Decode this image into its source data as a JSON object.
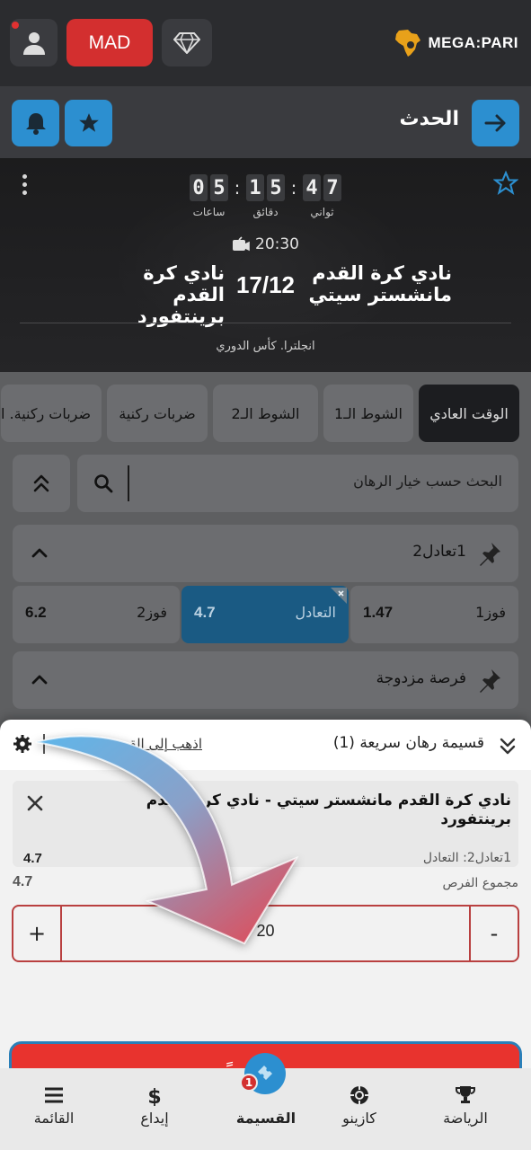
{
  "header": {
    "currency": "MAD",
    "logo_text": "MEGA:PARI",
    "icons": {
      "user": "user-icon",
      "gem": "diamond-icon",
      "logo": "africa-logo-icon"
    }
  },
  "event_bar": {
    "title": "الحدث",
    "icons": {
      "back": "arrow-right-icon",
      "bell": "bell-icon",
      "star": "star-icon"
    }
  },
  "match": {
    "timer": {
      "seconds": "47",
      "minutes": "15",
      "hours": "05",
      "seconds_label": "ثواني",
      "minutes_label": "دقائق",
      "hours_label": "ساعات"
    },
    "kickoff_time": "20:30",
    "home_team": "نادي كرة القدم مانشستر سيتي",
    "away_team": "نادي كرة القدم برينتفورد",
    "date": "17/12",
    "league": "انجلترا. كأس الدوري"
  },
  "market_tabs": [
    {
      "label": "الوقت العادي",
      "active": true
    },
    {
      "label": "الشوط الـ1",
      "active": false
    },
    {
      "label": "الشوط الـ2",
      "active": false
    },
    {
      "label": "ضربات ركنية",
      "active": false
    },
    {
      "label": "ضربات ركنية. ا",
      "active": false
    }
  ],
  "search": {
    "placeholder": "البحث حسب خيار الرهان"
  },
  "markets": [
    {
      "title": "1تعادل2",
      "outcomes": [
        {
          "label": "فوز1",
          "value": "1.47",
          "selected": false
        },
        {
          "label": "التعادل",
          "value": "4.7",
          "selected": true
        },
        {
          "label": "فوز2",
          "value": "6.2",
          "selected": false
        }
      ]
    },
    {
      "title": "فرصة مزدوجة"
    }
  ],
  "bet_slip": {
    "title": "قسيمة رهان سريعة (1)",
    "goto_link": "اذهب إلى القسيمة",
    "bet": {
      "match": "نادي كرة القدم مانشستر سيتي - نادي كرة القدم برينتفورد",
      "selection": "1تعادل2: التعادل",
      "odds": "4.7"
    },
    "total_odds_label": "مجموع الفرص",
    "total_odds": "4.7",
    "stake": "20",
    "plus": "+",
    "minus": "-",
    "place_bet": "ضع رهاناً"
  },
  "bottom_nav": [
    {
      "label": "الرياضة",
      "icon": "trophy-icon"
    },
    {
      "label": "كازينو",
      "icon": "casino-chip-icon"
    },
    {
      "label": "القسيمة",
      "icon": "ticket-icon",
      "badge": "1",
      "active": true
    },
    {
      "label": "إيداع",
      "icon": "dollar-icon"
    },
    {
      "label": "القائمة",
      "icon": "menu-icon"
    }
  ],
  "colors": {
    "accent_blue": "#2c8fd0",
    "brand_red": "#d32f2f",
    "place_bet_red": "#e8332e",
    "selected_odds": "#1a5a83"
  }
}
